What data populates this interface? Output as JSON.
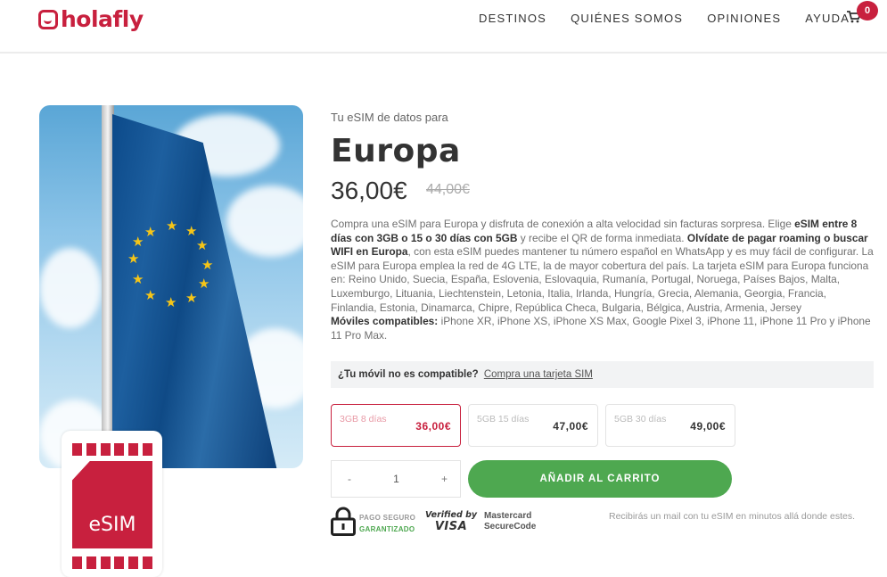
{
  "header": {
    "logo_text": "holafly",
    "nav": [
      "DESTINOS",
      "QUIÉNES SOMOS",
      "OPINIONES",
      "AYUDA"
    ],
    "cart_count": "0"
  },
  "product": {
    "subtitle": "Tu eSIM de datos para",
    "title": "Europa",
    "price": "36,00€",
    "old_price": "44,00€",
    "esim_label": "eSIM",
    "description": {
      "p1": "Compra una eSIM para Europa y disfruta de conexión a alta velocidad sin facturas sorpresa. Elige ",
      "b1": "eSIM entre 8 días con 3GB o 15 o 30 días con 5GB",
      "p2": " y recibe el QR de forma inmediata. ",
      "b2": "Olvídate de pagar roaming o buscar WIFI en Europa",
      "p3": ", con esta eSIM puedes mantener tu número español en WhatsApp y es muy fácil de configurar. La eSIM para Europa emplea la red de 4G LTE, la de mayor cobertura del país. La tarjeta eSIM para Europa funciona en: Reino Unido, Suecia, España, Eslovenia, Eslovaquia, Rumanía, Portugal, Noruega, Países Bajos, Malta, Luxemburgo, Lituania, Liechtenstein, Letonia, Italia, Irlanda, Hungría, Grecia, Alemania, Georgia, Francia, Finlandia, Estonia, Dinamarca, Chipre, República Checa, Bulgaria, Bélgica, Austria, Armenia, Jersey",
      "b3": "Móviles compatibles:",
      "p4": " iPhone XR, iPhone XS, iPhone XS Max, Google Pixel 3, iPhone 11, iPhone 11 Pro y iPhone 11 Pro Max."
    },
    "compat": {
      "question": "¿Tu móvil no es compatible?",
      "link": "Compra una tarjeta SIM"
    },
    "options": [
      {
        "name": "3GB 8 días",
        "price": "36,00€",
        "selected": true
      },
      {
        "name": "5GB 15 días",
        "price": "47,00€",
        "selected": false
      },
      {
        "name": "5GB 30 días",
        "price": "49,00€",
        "selected": false
      }
    ],
    "quantity": {
      "minus": "-",
      "value": "1",
      "plus": "+"
    },
    "add_to_cart": "AÑADIR AL CARRITO"
  },
  "trust": {
    "secure_1": "PAGO SEGURO",
    "secure_2": "GARANTIZADO",
    "visa_1": "Verified by",
    "visa_2": "VISA",
    "mc_1": "Mastercard",
    "mc_2": "SecureCode",
    "mail_note": "Recibirás un mail con tu eSIM en minutos allá donde estes."
  },
  "colors": {
    "brand": "#c8203e",
    "cta": "#4ea850"
  }
}
